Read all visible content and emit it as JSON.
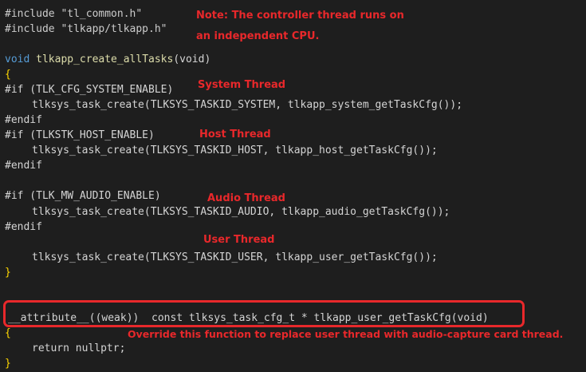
{
  "lines": {
    "l1": "#include \"tl_common.h\"",
    "l2": "#include \"tlkapp/tlkapp.h\"",
    "l3_kw": "void",
    "l3_fn": "tlkapp_create_allTasks",
    "l3_args": "(void)",
    "brace_open": "{",
    "if1": "#if (TLK_CFG_SYSTEM_ENABLE)",
    "call1": "tlksys_task_create(TLKSYS_TASKID_SYSTEM, tlkapp_system_getTaskCfg());",
    "endif1": "#endif",
    "if2": "#if (TLKSTK_HOST_ENABLE)",
    "call2": "tlksys_task_create(TLKSYS_TASKID_HOST, tlkapp_host_getTaskCfg());",
    "endif2": "#endif",
    "if3": "#if (TLK_MW_AUDIO_ENABLE)",
    "call3": "tlksys_task_create(TLKSYS_TASKID_AUDIO, tlkapp_audio_getTaskCfg());",
    "endif3": "#endif",
    "call4": "tlksys_task_create(TLKSYS_TASKID_USER, tlkapp_user_getTaskCfg());",
    "brace_close": "}",
    "attr_line": "__attribute__((weak))  const tlksys_task_cfg_t * tlkapp_user_getTaskCfg(void)",
    "brace_open2": "{",
    "return_line": "return nullptr;",
    "brace_close2": "}"
  },
  "notes": {
    "note_line1": "Note: The controller thread runs on",
    "note_line2": "an independent CPU.",
    "system": "System Thread",
    "host": "Host Thread",
    "audio": "Audio Thread",
    "user": "User Thread",
    "override": "Override this function to replace user thread with audio-capture card thread."
  },
  "colors": {
    "background": "#1e1e1e",
    "annotation": "#e8282b"
  }
}
